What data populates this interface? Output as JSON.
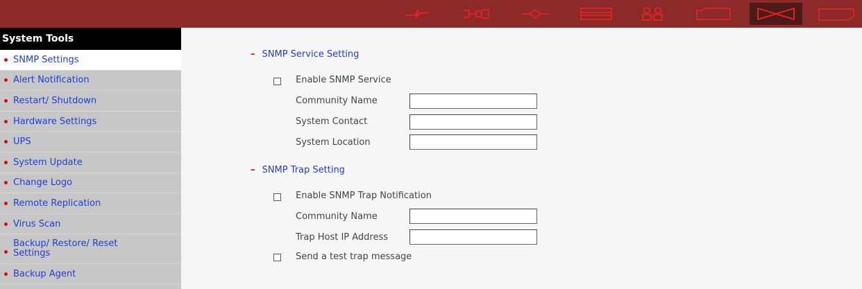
{
  "toolbar": {
    "icons": [
      "network-icon",
      "devices-icon",
      "services-icon",
      "disk-icon",
      "users-icon",
      "share-icon",
      "system-tools-icon",
      "logs-icon"
    ],
    "active": "system-tools-icon",
    "colors": {
      "bar": "#8c2a2a",
      "icon": "#ee2222",
      "active": "#4d1a1a"
    }
  },
  "sidebar": {
    "title": "System Tools",
    "items": [
      {
        "label": "SNMP Settings",
        "active": true
      },
      {
        "label": "Alert Notification"
      },
      {
        "label": "Restart/ Shutdown"
      },
      {
        "label": "Hardware Settings"
      },
      {
        "label": "UPS"
      },
      {
        "label": "System Update"
      },
      {
        "label": "Change Logo"
      },
      {
        "label": "Remote Replication"
      },
      {
        "label": "Virus Scan"
      },
      {
        "label": "Backup/ Restore/ Reset Settings"
      },
      {
        "label": "Backup Agent"
      }
    ]
  },
  "snmp_service": {
    "title": "SNMP Service Setting",
    "enable_label": "Enable SNMP Service",
    "enabled": false,
    "community_label": "Community Name",
    "community_value": "",
    "contact_label": "System Contact",
    "contact_value": "",
    "location_label": "System Location",
    "location_value": ""
  },
  "snmp_trap": {
    "title": "SNMP Trap Setting",
    "enable_label": "Enable SNMP Trap Notification",
    "enabled": false,
    "community_label": "Community Name",
    "community_value": "",
    "host_label": "Trap Host IP Address",
    "host_value": "",
    "test_label": "Send a test trap message",
    "test_checked": false
  }
}
